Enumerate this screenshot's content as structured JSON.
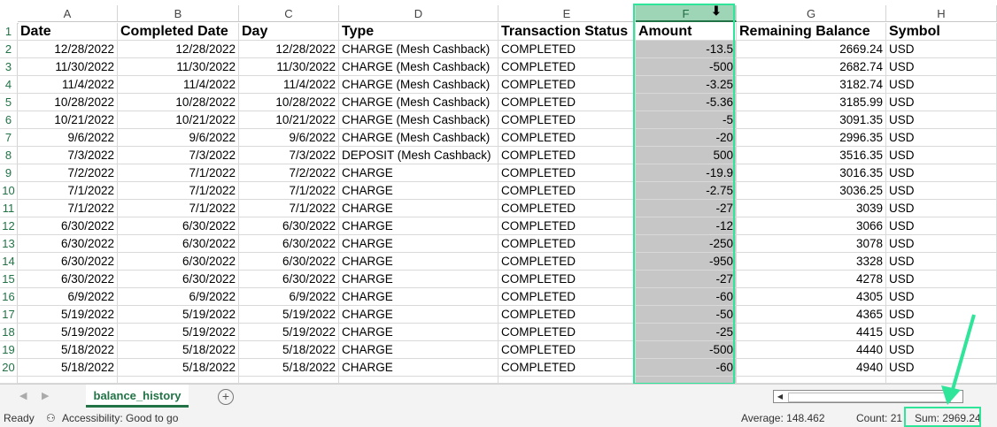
{
  "columns": [
    {
      "letter": "A"
    },
    {
      "letter": "B"
    },
    {
      "letter": "C"
    },
    {
      "letter": "D"
    },
    {
      "letter": "E"
    },
    {
      "letter": "F"
    },
    {
      "letter": "G"
    },
    {
      "letter": "H"
    }
  ],
  "header_row": [
    "Date",
    "Completed Date",
    "Day",
    "Type",
    "Transaction Status",
    "Amount",
    "Remaining Balance",
    "Symbol"
  ],
  "rows": [
    [
      "12/28/2022",
      "12/28/2022",
      "12/28/2022",
      "CHARGE (Mesh Cashback)",
      "COMPLETED",
      "-13.5",
      "2669.24",
      "USD"
    ],
    [
      "11/30/2022",
      "11/30/2022",
      "11/30/2022",
      "CHARGE (Mesh Cashback)",
      "COMPLETED",
      "-500",
      "2682.74",
      "USD"
    ],
    [
      "11/4/2022",
      "11/4/2022",
      "11/4/2022",
      "CHARGE (Mesh Cashback)",
      "COMPLETED",
      "-3.25",
      "3182.74",
      "USD"
    ],
    [
      "10/28/2022",
      "10/28/2022",
      "10/28/2022",
      "CHARGE (Mesh Cashback)",
      "COMPLETED",
      "-5.36",
      "3185.99",
      "USD"
    ],
    [
      "10/21/2022",
      "10/21/2022",
      "10/21/2022",
      "CHARGE (Mesh Cashback)",
      "COMPLETED",
      "-5",
      "3091.35",
      "USD"
    ],
    [
      "9/6/2022",
      "9/6/2022",
      "9/6/2022",
      "CHARGE (Mesh Cashback)",
      "COMPLETED",
      "-20",
      "2996.35",
      "USD"
    ],
    [
      "7/3/2022",
      "7/3/2022",
      "7/3/2022",
      "DEPOSIT (Mesh Cashback)",
      "COMPLETED",
      "500",
      "3516.35",
      "USD"
    ],
    [
      "7/2/2022",
      "7/1/2022",
      "7/2/2022",
      "CHARGE",
      "COMPLETED",
      "-19.9",
      "3016.35",
      "USD"
    ],
    [
      "7/1/2022",
      "7/1/2022",
      "7/1/2022",
      "CHARGE",
      "COMPLETED",
      "-2.75",
      "3036.25",
      "USD"
    ],
    [
      "7/1/2022",
      "7/1/2022",
      "7/1/2022",
      "CHARGE",
      "COMPLETED",
      "-27",
      "3039",
      "USD"
    ],
    [
      "6/30/2022",
      "6/30/2022",
      "6/30/2022",
      "CHARGE",
      "COMPLETED",
      "-12",
      "3066",
      "USD"
    ],
    [
      "6/30/2022",
      "6/30/2022",
      "6/30/2022",
      "CHARGE",
      "COMPLETED",
      "-250",
      "3078",
      "USD"
    ],
    [
      "6/30/2022",
      "6/30/2022",
      "6/30/2022",
      "CHARGE",
      "COMPLETED",
      "-950",
      "3328",
      "USD"
    ],
    [
      "6/30/2022",
      "6/30/2022",
      "6/30/2022",
      "CHARGE",
      "COMPLETED",
      "-27",
      "4278",
      "USD"
    ],
    [
      "6/9/2022",
      "6/9/2022",
      "6/9/2022",
      "CHARGE",
      "COMPLETED",
      "-60",
      "4305",
      "USD"
    ],
    [
      "5/19/2022",
      "5/19/2022",
      "5/19/2022",
      "CHARGE",
      "COMPLETED",
      "-50",
      "4365",
      "USD"
    ],
    [
      "5/19/2022",
      "5/19/2022",
      "5/19/2022",
      "CHARGE",
      "COMPLETED",
      "-25",
      "4415",
      "USD"
    ],
    [
      "5/18/2022",
      "5/18/2022",
      "5/18/2022",
      "CHARGE",
      "COMPLETED",
      "-500",
      "4440",
      "USD"
    ],
    [
      "5/18/2022",
      "5/18/2022",
      "5/18/2022",
      "CHARGE",
      "COMPLETED",
      "-60",
      "4940",
      "USD"
    ]
  ],
  "sheet_tab": "balance_history",
  "status": {
    "ready": "Ready",
    "accessibility": "Accessibility: Good to go",
    "average": "Average: 148.462",
    "count": "Count: 21",
    "sum": "Sum: 2969.24"
  },
  "colors": {
    "accent": "#217346",
    "highlight": "#2fe59a",
    "selection": "#c6c6c6"
  },
  "icons": {
    "add_sheet": "plus-circle-icon",
    "accessibility": "accessibility-icon",
    "cursor": "column-select-cursor-icon"
  }
}
